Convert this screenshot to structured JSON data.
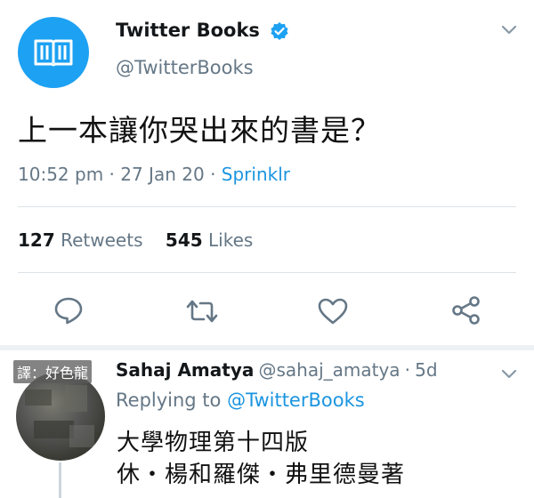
{
  "tweet": {
    "account_name": "Twitter Books",
    "handle": "@TwitterBooks",
    "text": "上一本讓你哭出來的書是？",
    "time": "10:52 pm",
    "date": "27 Jan 20",
    "source": "Sprinklr",
    "dot": "·",
    "retweets_count": "127",
    "retweets_label": "Retweets",
    "likes_count": "545",
    "likes_label": "Likes"
  },
  "reply": {
    "watermark": "譯：好色龍",
    "name": "Sahaj Amatya",
    "handle": "@sahaj_amatya",
    "age": "5d",
    "dot": "·",
    "replying_prefix": "Replying to",
    "replying_handle": "@TwitterBooks",
    "text_line1": "大學物理第十四版",
    "text_line2": "休・楊和羅傑・弗里德曼著"
  },
  "colors": {
    "brand_blue": "#1da1f2",
    "link_blue": "#1b95e0",
    "secondary_text": "#657786"
  },
  "icons": [
    "book-logo-icon",
    "verified-badge-icon",
    "chevron-down-icon",
    "reply-icon",
    "retweet-icon",
    "like-icon",
    "share-icon"
  ]
}
